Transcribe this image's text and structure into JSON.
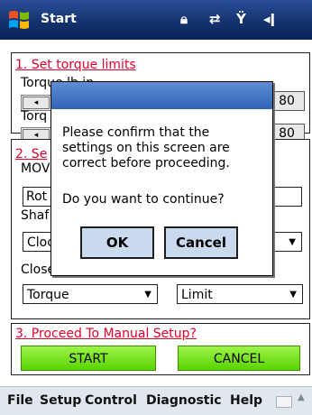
{
  "titlebar": {
    "title": "Start",
    "icons": [
      "lock-icon",
      "network-icon",
      "signal-off-icon",
      "volume-icon"
    ]
  },
  "section1": {
    "title": "1. Set torque limits",
    "label_top": "Torque lb in",
    "label_bottom": "Torq",
    "value_top": "80",
    "value_bottom": "80"
  },
  "section2": {
    "title": "2. Se",
    "mov_label": "MOV",
    "rot_value": "Rot",
    "shaft_label": "Shaf",
    "clock_value": "Cloc",
    "close_label": "Close",
    "torque_value": "Torque",
    "limit_value": "Limit"
  },
  "section3": {
    "title": "3. Proceed To Manual Setup?",
    "start_label": "START",
    "cancel_label": "CANCEL"
  },
  "dialog": {
    "message_lines": [
      "Please confirm that the",
      "settings on this screen are",
      "correct before proceeding."
    ],
    "question": "Do you want to continue?",
    "ok_label": "OK",
    "cancel_label": "Cancel"
  },
  "menubar": {
    "items": [
      "File",
      "Setup",
      "Control",
      "Diagnostic",
      "Help"
    ]
  },
  "colors": {
    "title_bar": "#14326f",
    "section_title": "#e0002a",
    "green_button": "#58d400",
    "dialog_button": "#c9d9ee",
    "menubar": "#e1e7ee"
  }
}
